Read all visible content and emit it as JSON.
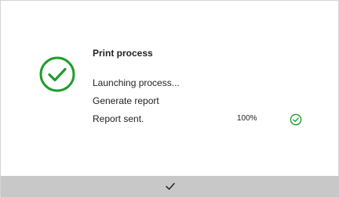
{
  "dialog": {
    "title": "Print process",
    "lines": [
      "Launching process...",
      "Generate report",
      "Report sent."
    ],
    "progress_label": "100%",
    "progress": 1.0,
    "status_icon": "check-circle-icon",
    "status_color": "#1f9d2b"
  },
  "footer": {
    "confirm_icon": "checkmark-icon"
  }
}
